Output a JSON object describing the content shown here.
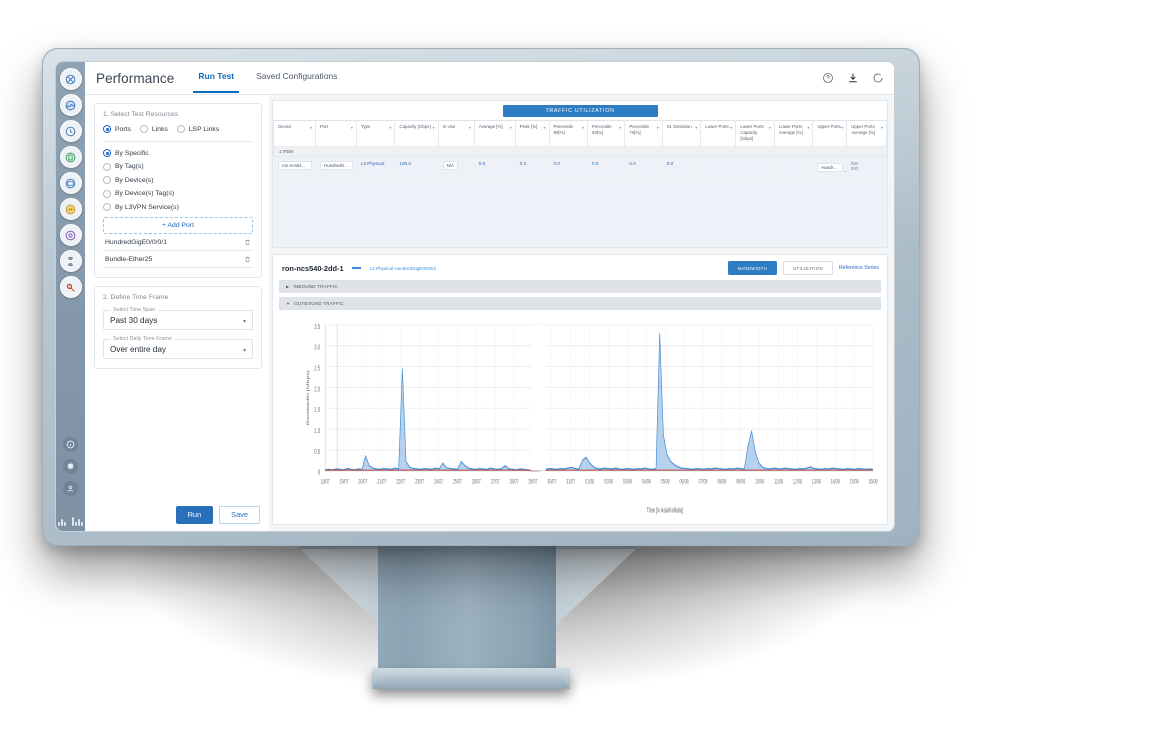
{
  "app": {
    "title": "Performance",
    "tabs": [
      {
        "label": "Run Test",
        "active": true
      },
      {
        "label": "Saved Configurations",
        "active": false
      }
    ],
    "header_icons": [
      "help-circle-icon",
      "download-icon",
      "refresh-icon"
    ]
  },
  "iconbar": {
    "items": [
      "network-topology-icon",
      "performance-wave-icon",
      "clock-icon",
      "device-icon",
      "traffic-meter-icon",
      "circuit-icon",
      "services-icon",
      "alarm-icon",
      "admin-tools-icon"
    ],
    "bottom_items": [
      "info-icon",
      "gear-icon",
      "user-icon"
    ],
    "logo": "cisco-logo"
  },
  "left_panel": {
    "step1": {
      "title": "1. Select Test Resources",
      "resource_type": [
        {
          "label": "Ports",
          "selected": true
        },
        {
          "label": "Links",
          "selected": false
        },
        {
          "label": "LSP Links",
          "selected": false
        }
      ],
      "selection_mode": [
        {
          "label": "By Specific",
          "selected": true
        },
        {
          "label": "By Tag(s)",
          "selected": false
        },
        {
          "label": "By Device(s)",
          "selected": false
        },
        {
          "label": "By Device(s) Tag(s)",
          "selected": false
        },
        {
          "label": "By L3VPN Service(s)",
          "selected": false
        }
      ],
      "add_button": "+  Add Port",
      "ports": [
        {
          "name": "HundredGigE0/0/0/1",
          "delete_icon": "trash-icon"
        },
        {
          "name": "Bundle-Ether25",
          "delete_icon": "trash-icon"
        }
      ]
    },
    "step2": {
      "title": "2. Define Time Frame",
      "time_span": {
        "label": "Select Time Span",
        "value": "Past 30 days"
      },
      "daily_frame": {
        "label": "Select Daily Time Frame",
        "value": "Over entire day"
      }
    },
    "actions": {
      "run": "Run",
      "save": "Save"
    }
  },
  "main": {
    "tab_pill": "TRAFFIC UTILIZATION",
    "table": {
      "columns": [
        "Device",
        "Port",
        "Type",
        "Capacity [Gbps]",
        "In Use",
        "Average [%]",
        "Peak [%]",
        "Percentile 90[%]",
        "Percentile 93[%]",
        "Percentile 70[%]",
        "St. Deviation",
        "Lower Ports",
        "Lower Ports Capacity [Gbps]",
        "Lower Ports Average [%]",
        "Upper Ports",
        "Upper Ports Average [%]"
      ],
      "group_label": "1 ITEM",
      "rows": [
        {
          "device": "ron-ncs540-...",
          "port": "HundredGi...",
          "type": "L3 Physical",
          "capacity": "100.0",
          "in_use": "N/A",
          "average": "0.0",
          "peak": "0.3",
          "p90": "0.0",
          "p93": "0.0",
          "p70": "0.0",
          "st_dev": "0.0",
          "lower_ports": "",
          "lower_capacity": "",
          "lower_average": "",
          "upper_ports": [
            "Hundred...",
            "Hundred..."
          ],
          "upper_average": [
            "0.0",
            "0.0"
          ]
        }
      ]
    },
    "chart_header": {
      "title": "ron-ncs540-2dd-1",
      "legend": "L3 Physical HundredGigE0/0/0/1",
      "buttons": [
        {
          "label": "BANDWIDTH",
          "active": true
        },
        {
          "label": "UTILIZATION",
          "active": false
        }
      ],
      "reference_link": "Reference Series"
    },
    "accordions": [
      {
        "label": "INBOUND TRAFFIC",
        "expanded": false,
        "icon": "chevron-right-icon"
      },
      {
        "label": "OUTBOUND TRAFFIC",
        "expanded": true,
        "icon": "chevron-down-icon"
      }
    ]
  },
  "chart_data": {
    "type": "area",
    "title": "OUTBOUND TRAFFIC",
    "xlabel": "Time [in Asia/Kolkata]",
    "ylabel": "Bandwidth [Mbps]",
    "ylim": [
      0,
      3.5
    ],
    "yticks": [
      0,
      0.5,
      1.0,
      1.5,
      2.0,
      2.5,
      3.0,
      3.5
    ],
    "ytick_labels": [
      "0",
      "0.5",
      "1.0",
      "1.5",
      "2.0",
      "2.5",
      "3.0",
      "3.5"
    ],
    "xtick_labels": [
      "18/07",
      "19/07",
      "20/07",
      "21/07",
      "22/07",
      "23/07",
      "24/07",
      "25/07",
      "26/07",
      "27/07",
      "28/07",
      "29/07",
      "30/07",
      "31/07",
      "01/08",
      "02/08",
      "03/08",
      "04/08",
      "05/08",
      "06/08",
      "07/08",
      "08/08",
      "09/08",
      "10/08",
      "11/08",
      "12/08",
      "13/08",
      "14/08",
      "15/08",
      "16/08"
    ],
    "grid": true,
    "legend_position": "top-left",
    "series": [
      {
        "name": "L3 Physical HundredGigE0/0/0/1",
        "color": "#3f8ad6",
        "fill": "#a9c9e9",
        "values": [
          0.02,
          0.03,
          0.02,
          0.04,
          0.03,
          0.02,
          0.05,
          0.03,
          0.02,
          0.04,
          0.03,
          0.35,
          0.12,
          0.06,
          0.04,
          0.03,
          0.05,
          0.04,
          0.03,
          0.06,
          0.04,
          2.45,
          0.22,
          0.08,
          0.05,
          0.04,
          0.03,
          0.05,
          0.04,
          0.03,
          0.06,
          0.04,
          0.18,
          0.07,
          0.05,
          0.04,
          0.03,
          0.22,
          0.12,
          0.06,
          0.04,
          0.03,
          0.05,
          0.04,
          0.03,
          0.06,
          0.04,
          0.03,
          0.05,
          0.12,
          0.04,
          0.03,
          0.02,
          0.04,
          0.03,
          0.02,
          0.0,
          0.0,
          0.0,
          0.02,
          0.03,
          0.05,
          0.04,
          0.03,
          0.05,
          0.04,
          0.06,
          0.08,
          0.05,
          0.04,
          0.25,
          0.32,
          0.18,
          0.09,
          0.05,
          0.04,
          0.06,
          0.05,
          0.04,
          0.06,
          0.04,
          0.03,
          0.05,
          0.04,
          0.03,
          0.05,
          0.04,
          0.06,
          0.04,
          0.03,
          0.05,
          3.3,
          0.85,
          0.38,
          0.22,
          0.14,
          0.09,
          0.06,
          0.05,
          0.04,
          0.03,
          0.05,
          0.04,
          0.03,
          0.05,
          0.04,
          0.06,
          0.05,
          0.04,
          0.03,
          0.05,
          0.04,
          0.06,
          0.05,
          0.04,
          0.6,
          0.95,
          0.45,
          0.18,
          0.08,
          0.05,
          0.04,
          0.06,
          0.05,
          0.04,
          0.06,
          0.05,
          0.04,
          0.03,
          0.05,
          0.04,
          0.06,
          0.09,
          0.05,
          0.04,
          0.03,
          0.05,
          0.04,
          0.06,
          0.05,
          0.04,
          0.03,
          0.05,
          0.04,
          0.03,
          0.05,
          0.04,
          0.03,
          0.04,
          0.03
        ]
      },
      {
        "name": "threshold",
        "color": "#c0392b",
        "values": [
          0.012,
          0.012,
          0.012,
          0.012,
          0.012,
          0.012,
          0.012,
          0.012,
          0.012,
          0.012,
          0.012,
          0.012,
          0.012,
          0.012,
          0.012,
          0.012,
          0.012,
          0.012,
          0.012,
          0.012,
          0.012,
          0.012,
          0.012,
          0.012,
          0.012,
          0.012,
          0.012,
          0.012,
          0.012,
          0.012,
          0.012,
          0.012,
          0.012,
          0.012,
          0.012,
          0.012,
          0.012,
          0.012,
          0.012,
          0.012,
          0.012,
          0.012,
          0.012,
          0.012,
          0.012,
          0.012,
          0.012,
          0.012,
          0.012,
          0.012,
          0.012,
          0.012,
          0.012,
          0.012,
          0.012,
          0.012,
          0.0,
          0.0,
          0.0,
          0.012,
          0.012,
          0.012,
          0.012,
          0.012,
          0.012,
          0.012,
          0.012,
          0.012,
          0.012,
          0.012,
          0.012,
          0.012,
          0.012,
          0.012,
          0.012,
          0.012,
          0.012,
          0.012,
          0.012,
          0.012,
          0.012,
          0.012,
          0.012,
          0.012,
          0.012,
          0.012,
          0.012,
          0.012,
          0.012,
          0.012,
          0.012,
          0.012,
          0.012,
          0.012,
          0.012,
          0.012,
          0.012,
          0.012,
          0.012,
          0.012,
          0.012,
          0.012,
          0.012,
          0.012,
          0.012,
          0.012,
          0.012,
          0.012,
          0.012,
          0.012,
          0.012,
          0.012,
          0.012,
          0.012,
          0.012,
          0.012,
          0.012,
          0.012,
          0.012,
          0.012,
          0.012,
          0.012,
          0.012,
          0.012,
          0.012,
          0.012,
          0.012,
          0.012,
          0.012,
          0.012,
          0.012,
          0.012,
          0.012,
          0.012,
          0.012,
          0.012,
          0.012,
          0.012,
          0.012,
          0.012,
          0.012,
          0.012,
          0.012,
          0.012,
          0.012,
          0.012,
          0.012,
          0.012,
          0.012,
          0.012
        ]
      }
    ]
  },
  "colors": {
    "accent": "#2e7dc4",
    "link": "#2f68b5",
    "bezel": "#a9bcc8",
    "series": "#3f8ad6",
    "threshold": "#c0392b"
  }
}
